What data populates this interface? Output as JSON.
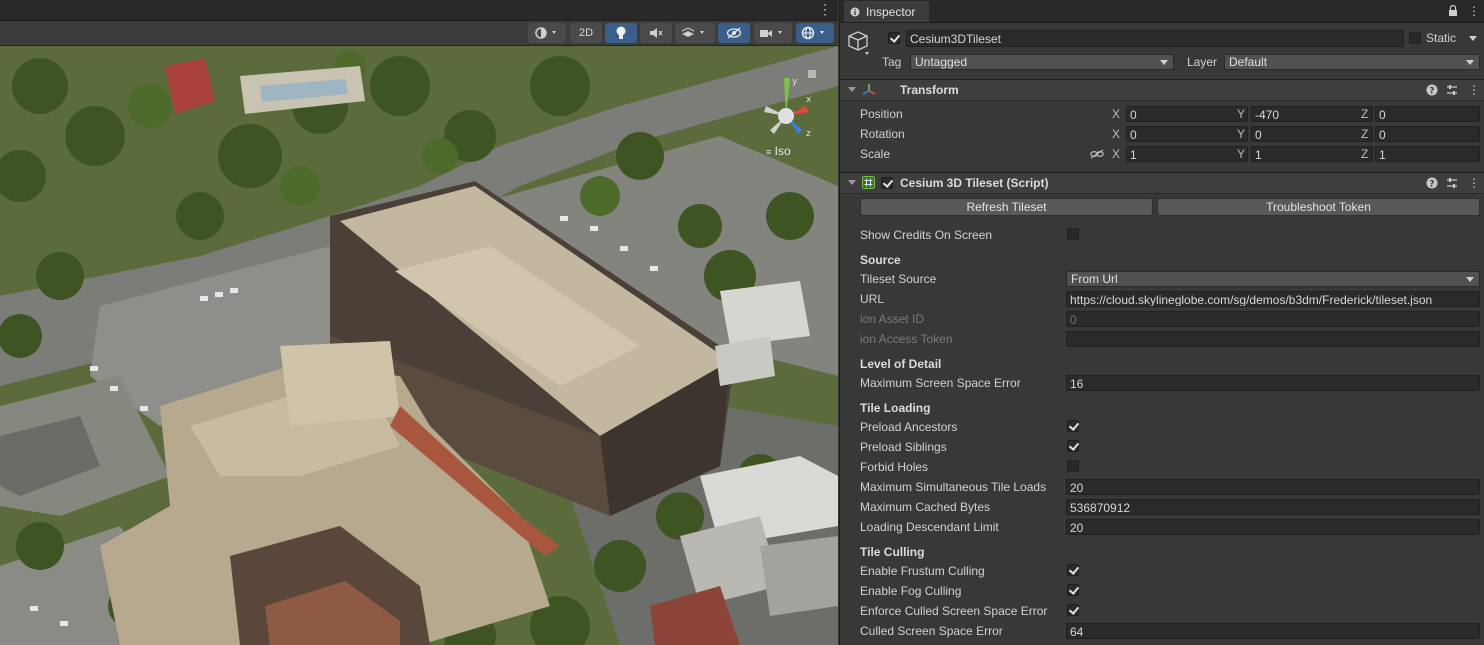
{
  "scene": {
    "menu_glyph": "⋮",
    "toolbar": {
      "mode_2d": "2D"
    }
  },
  "inspector": {
    "tab_label": "Inspector",
    "object": {
      "name": "Cesium3DTileset",
      "static_label": "Static",
      "tag_label": "Tag",
      "tag_value": "Untagged",
      "layer_label": "Layer",
      "layer_value": "Default"
    },
    "transform": {
      "title": "Transform",
      "position_label": "Position",
      "rotation_label": "Rotation",
      "scale_label": "Scale",
      "x": "X",
      "y": "Y",
      "z": "Z",
      "position": [
        "0",
        "-470",
        "0"
      ],
      "rotation": [
        "0",
        "0",
        "0"
      ],
      "scale": [
        "1",
        "1",
        "1"
      ]
    },
    "tileset": {
      "title": "Cesium 3D Tileset (Script)",
      "refresh_button": "Refresh Tileset",
      "troubleshoot_button": "Troubleshoot Token",
      "show_credits_label": "Show Credits On Screen",
      "show_credits": false,
      "source_header": "Source",
      "tileset_source_label": "Tileset Source",
      "tileset_source_value": "From Url",
      "url_label": "URL",
      "url_value": "https://cloud.skylineglobe.com/sg/demos/b3dm/Frederick/tileset.json",
      "ion_asset_label": "ion Asset ID",
      "ion_asset_value": "0",
      "ion_token_label": "ion Access Token",
      "ion_token_value": "",
      "lod_header": "Level of Detail",
      "max_sse_label": "Maximum Screen Space Error",
      "max_sse_value": "16",
      "tile_loading_header": "Tile Loading",
      "preload_ancestors_label": "Preload Ancestors",
      "preload_ancestors": true,
      "preload_siblings_label": "Preload Siblings",
      "preload_siblings": true,
      "forbid_holes_label": "Forbid Holes",
      "forbid_holes": false,
      "max_sim_loads_label": "Maximum Simultaneous Tile Loads",
      "max_sim_loads_value": "20",
      "max_cached_label": "Maximum Cached Bytes",
      "max_cached_value": "536870912",
      "loading_desc_label": "Loading Descendant Limit",
      "loading_desc_value": "20",
      "tile_culling_header": "Tile Culling",
      "frustum_label": "Enable Frustum Culling",
      "frustum": true,
      "fog_label": "Enable Fog Culling",
      "fog": true,
      "enforce_label": "Enforce Culled Screen Space Error",
      "enforce": true,
      "culled_sse_label": "Culled Screen Space Error",
      "culled_sse_value": "64"
    },
    "gizmo_iso": "Iso"
  }
}
